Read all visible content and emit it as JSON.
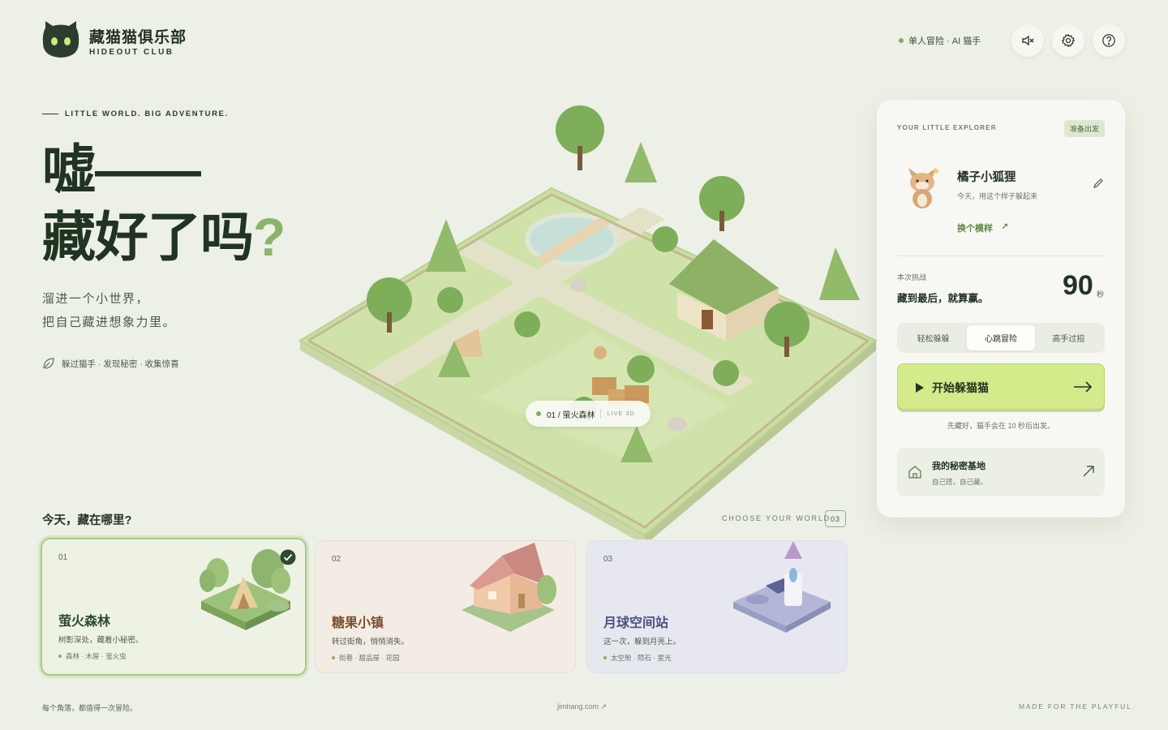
{
  "brand": {
    "title": "藏猫猫俱乐部",
    "subtitle": "HIDEOUT CLUB"
  },
  "header": {
    "mode": "单人冒险 · AI 猫手",
    "icons": [
      "mute-icon",
      "settings-icon",
      "help-icon"
    ]
  },
  "hero": {
    "tagline": "LITTLE WORLD. BIG ADVENTURE.",
    "line1": "嘘——",
    "line2": "藏好了吗",
    "line2_mark": "?",
    "sub1": "溜进一个小世界，",
    "sub2": "把自己藏进想象力里。",
    "features": "躲过猫手 · 发现秘密 · 收集惊喜"
  },
  "map": {
    "chip_label": "01 / 萤火森林",
    "chip_live": "LIVE 3D"
  },
  "worlds": {
    "question": "今天，藏在哪里?",
    "choose_label": "CHOOSE YOUR WORLD",
    "count": "03",
    "items": [
      {
        "num": "01",
        "name": "萤火森林",
        "desc": "树影深处，藏着小秘密。",
        "tags": "森林 · 木屋 · 萤火虫"
      },
      {
        "num": "02",
        "name": "糖果小镇",
        "desc": "转过街角，悄悄消失。",
        "tags": "街巷 · 甜品屋 · 花园"
      },
      {
        "num": "03",
        "name": "月球空间站",
        "desc": "这一次，躲到月亮上。",
        "tags": "太空舱 · 陨石 · 星光"
      }
    ]
  },
  "panel": {
    "label": "YOUR LITTLE EXPLORER",
    "status": "准备出发",
    "character": {
      "name": "橘子小狐狸",
      "desc": "今天，用这个样子躲起来",
      "change": "换个模样"
    },
    "challenge": {
      "label": "本次挑战",
      "text": "藏到最后，就算赢。",
      "time": "90",
      "unit": "秒"
    },
    "difficulty": [
      "轻松躲躲",
      "心跳冒险",
      "高手过招"
    ],
    "start": {
      "label": "开始躲猫猫",
      "note": "先藏好，猫手会在 10 秒后出发。"
    },
    "base": {
      "title": "我的秘密基地",
      "sub": "自己搭，自己藏。"
    }
  },
  "footer": {
    "left": "每个角落，都值得一次冒险。",
    "center": "jimhang.com ↗",
    "right": "MADE FOR THE PLAYFUL."
  },
  "colors": {
    "accent": "#d3eb8a",
    "brand_dark": "#233323",
    "green_mark": "#8cb36a"
  }
}
